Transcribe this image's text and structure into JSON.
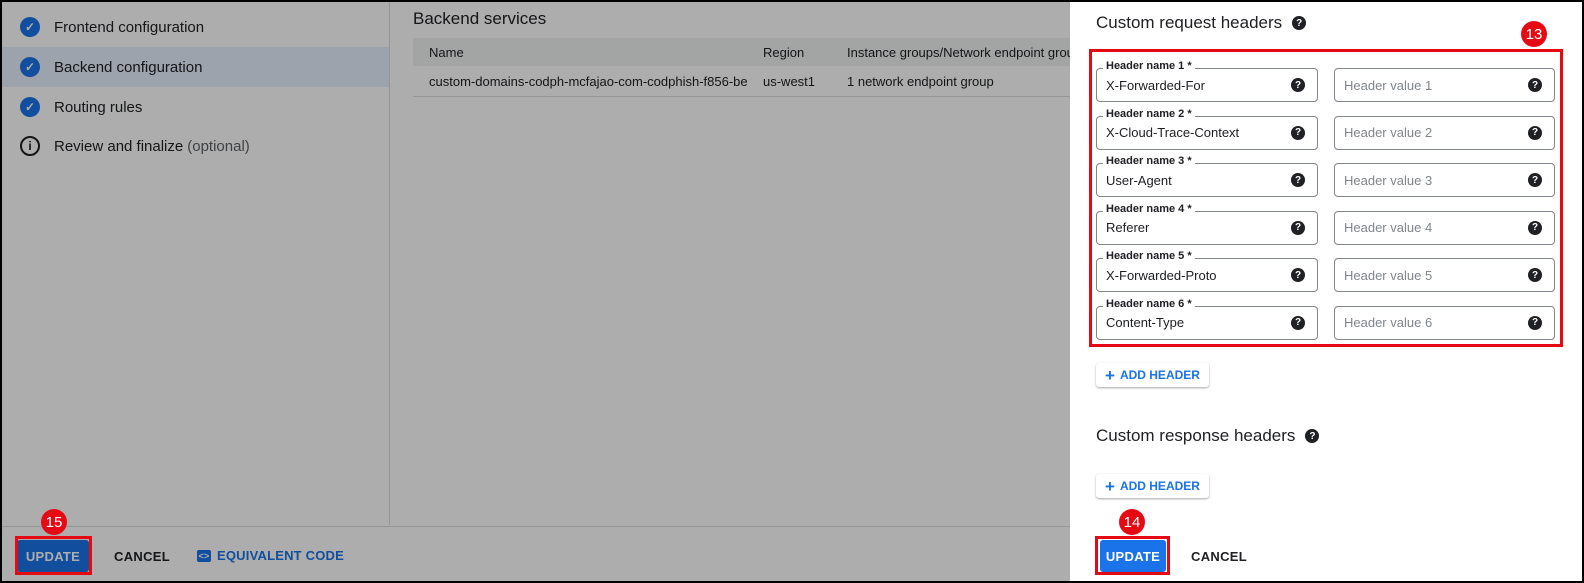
{
  "steps": [
    {
      "label": "Frontend configuration",
      "status": "done",
      "active": false
    },
    {
      "label": "Backend configuration",
      "status": "done",
      "active": true
    },
    {
      "label": "Routing rules",
      "status": "done",
      "active": false
    },
    {
      "label": "Review and finalize",
      "optional": "(optional)",
      "status": "info",
      "active": false
    }
  ],
  "backend": {
    "title": "Backend services",
    "columns": [
      "Name",
      "Region",
      "Instance groups/Network endpoint grou"
    ],
    "rows": [
      [
        "custom-domains-codph-mcfajao-com-codphish-f856-be",
        "us-west1",
        "1 network endpoint group"
      ]
    ]
  },
  "bottom": {
    "update": "UPDATE",
    "cancel": "CANCEL",
    "equivalent_code": "EQUIVALENT CODE"
  },
  "panel": {
    "request_title": "Custom request headers",
    "response_title": "Custom response headers",
    "headers": [
      {
        "name_label": "Header name 1 *",
        "name": "X-Forwarded-For",
        "value_placeholder": "Header value 1"
      },
      {
        "name_label": "Header name 2 *",
        "name": "X-Cloud-Trace-Context",
        "value_placeholder": "Header value 2"
      },
      {
        "name_label": "Header name 3 *",
        "name": "User-Agent",
        "value_placeholder": "Header value 3"
      },
      {
        "name_label": "Header name 4 *",
        "name": "Referer",
        "value_placeholder": "Header value 4"
      },
      {
        "name_label": "Header name 5 *",
        "name": "X-Forwarded-Proto",
        "value_placeholder": "Header value 5"
      },
      {
        "name_label": "Header name 6 *",
        "name": "Content-Type",
        "value_placeholder": "Header value 6"
      }
    ],
    "add_header": "ADD HEADER",
    "update": "UPDATE",
    "cancel": "CANCEL"
  },
  "annotations": {
    "b13": "13",
    "b14": "14",
    "b15": "15"
  },
  "colors": {
    "accent": "#1a73e8",
    "highlight": "#e50914"
  }
}
